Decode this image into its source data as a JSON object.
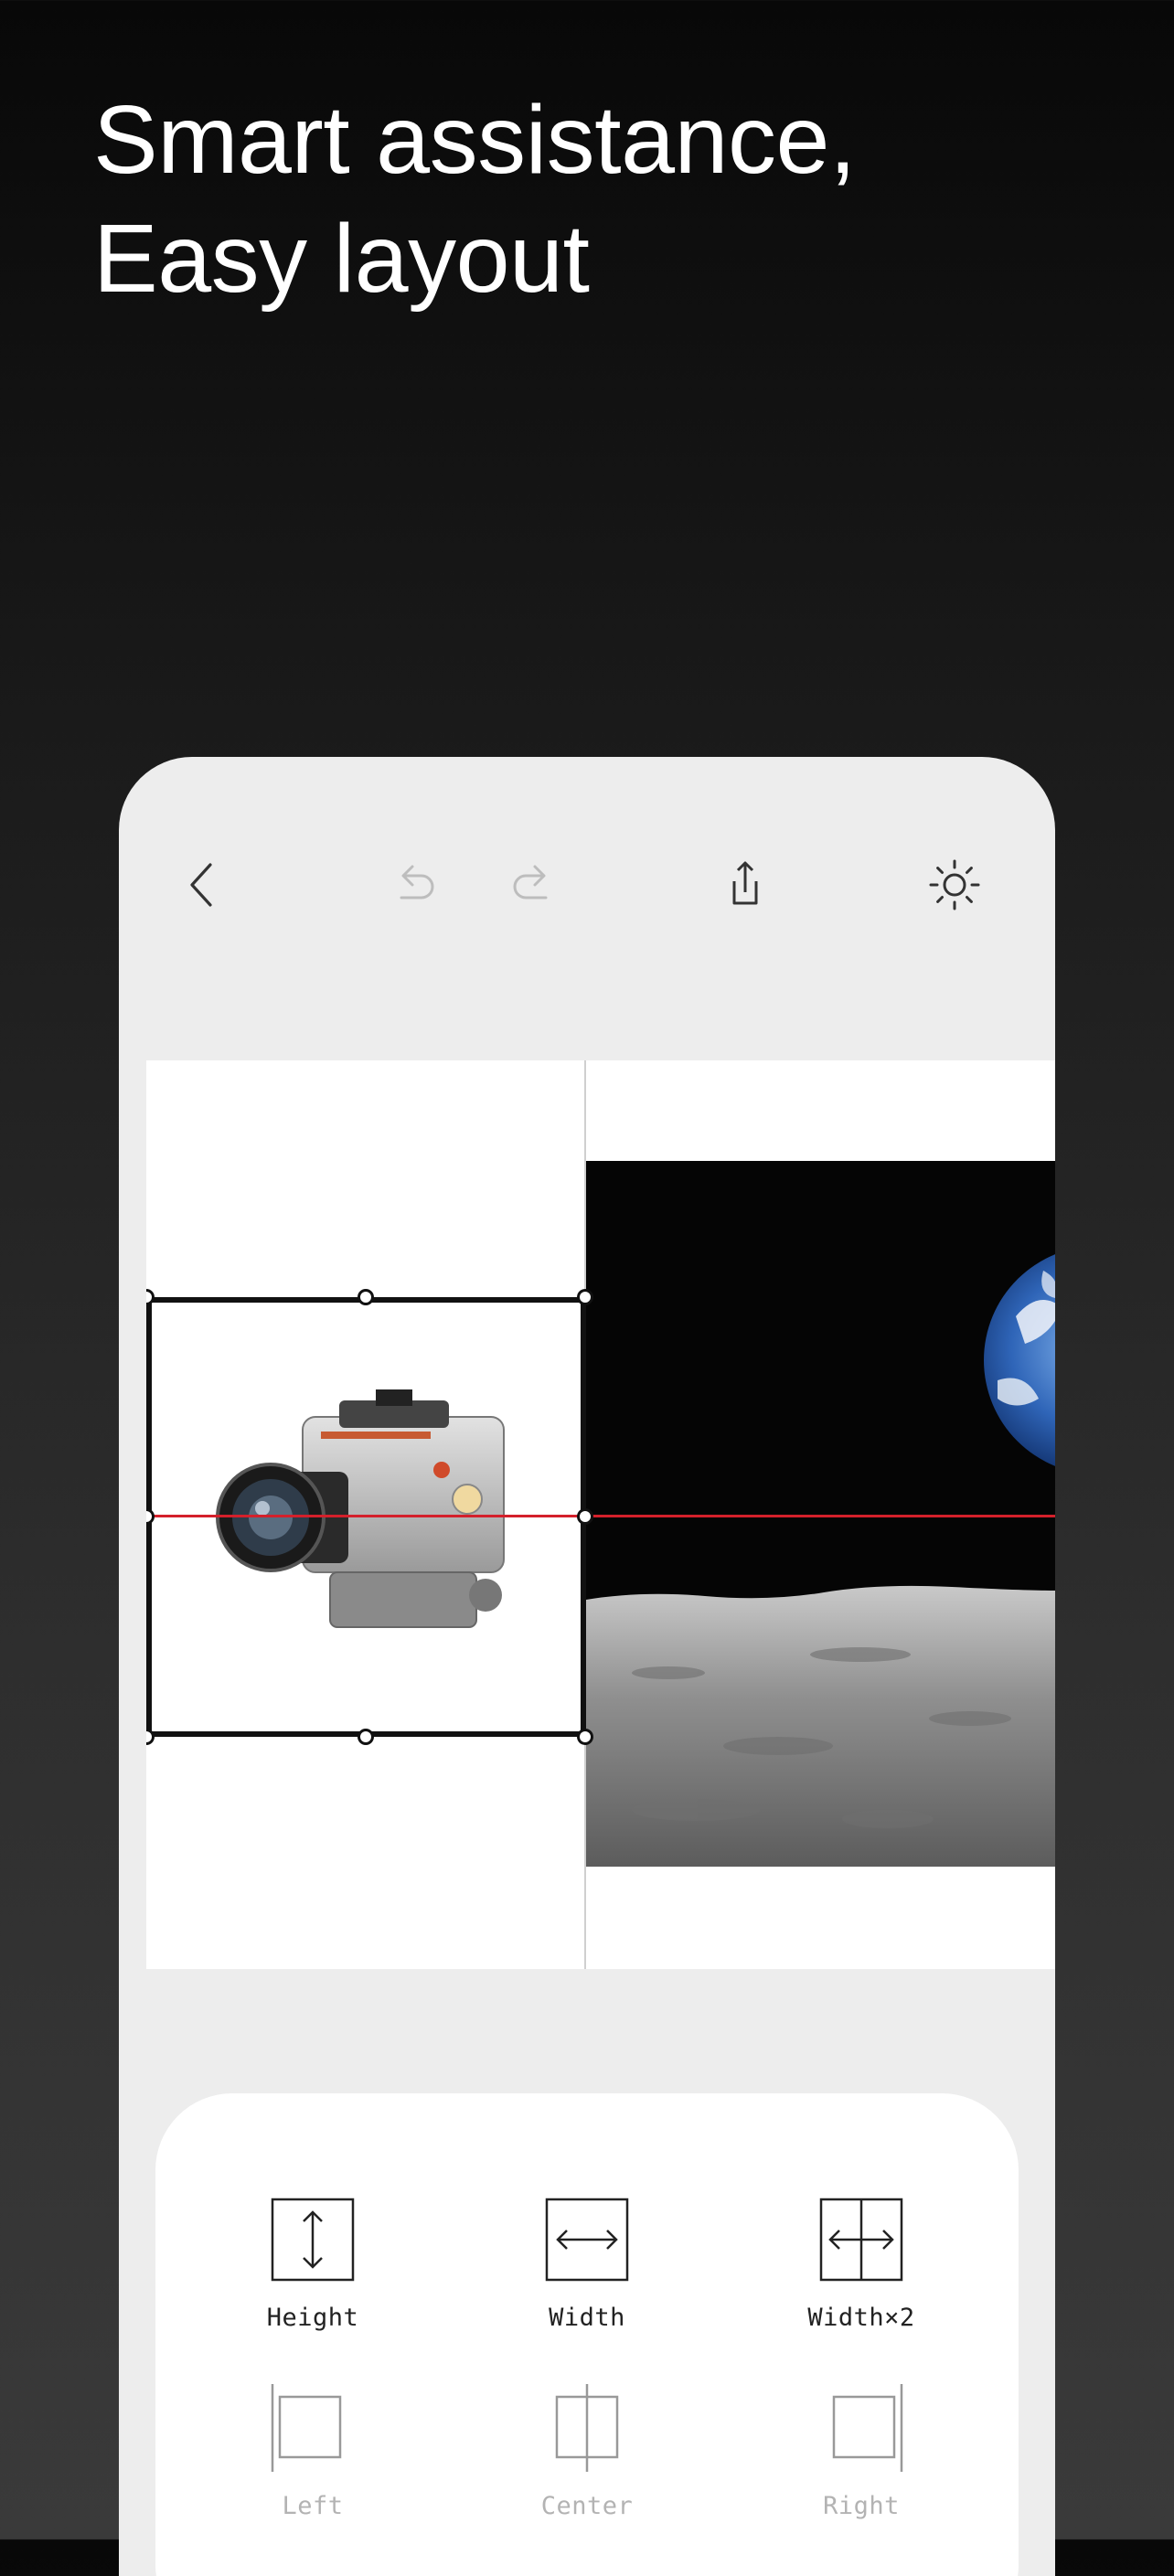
{
  "headline": {
    "line1": "Smart assistance,",
    "line2": "Easy layout"
  },
  "toolbar": {
    "back_icon": "chevron-left-icon",
    "undo_icon": "undo-icon",
    "redo_icon": "redo-icon",
    "share_icon": "share-icon",
    "brightness_icon": "sun-icon"
  },
  "canvas": {
    "left_image": "vintage silver camera",
    "right_image": "earthrise over lunar surface",
    "guide_color": "#d4202b"
  },
  "tools": {
    "row1": [
      {
        "label": "Height",
        "icon": "height-icon",
        "enabled": true
      },
      {
        "label": "Width",
        "icon": "width-icon",
        "enabled": true
      },
      {
        "label": "Width×2",
        "icon": "width-double-icon",
        "enabled": true
      }
    ],
    "row2": [
      {
        "label": "Left",
        "icon": "align-left-icon",
        "enabled": false
      },
      {
        "label": "Center",
        "icon": "align-center-icon",
        "enabled": false
      },
      {
        "label": "Right",
        "icon": "align-right-icon",
        "enabled": false
      }
    ]
  }
}
